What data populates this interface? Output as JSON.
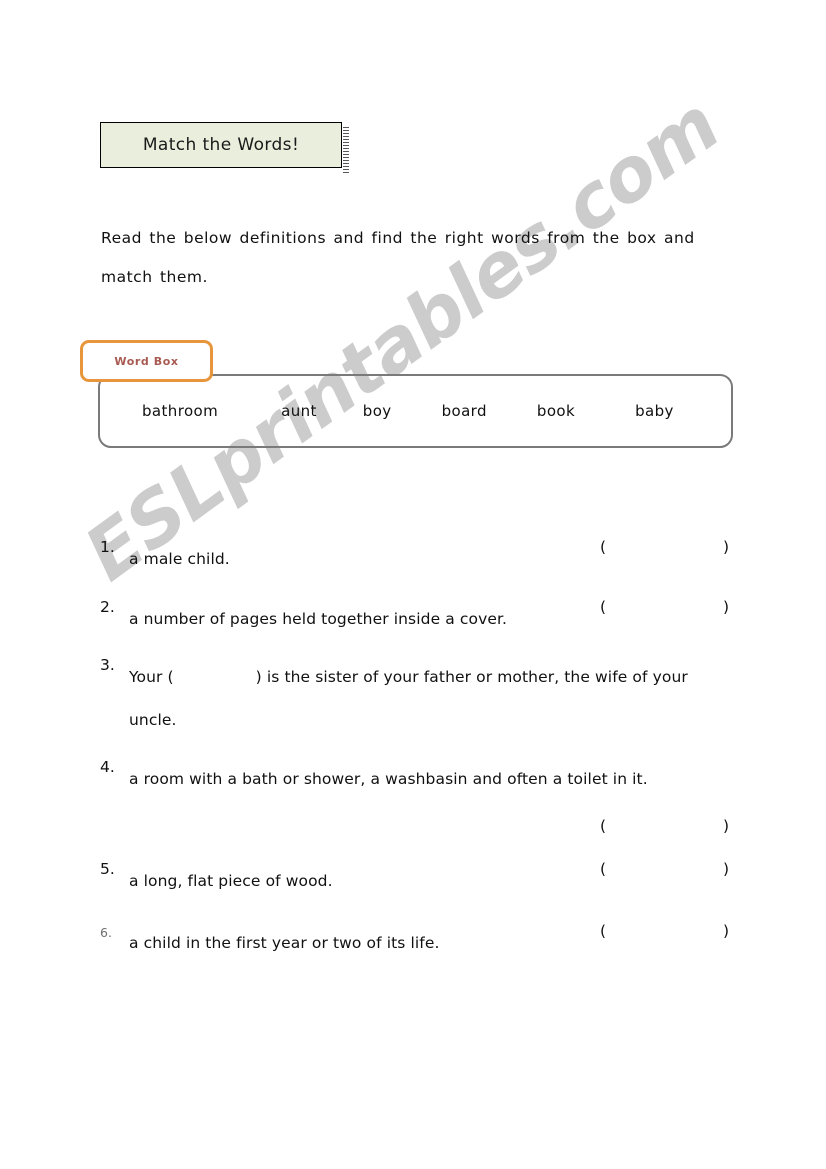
{
  "document": {
    "title": "Match the Words!",
    "instructions": "Read the below definitions and find the right words from the box and match them.",
    "watermark": "ESLprintables.com"
  },
  "word_box": {
    "tab_label": "Word Box",
    "words": [
      "bathroom",
      "aunt",
      "boy",
      "board",
      "book",
      "baby"
    ]
  },
  "questions": [
    {
      "number": "1.",
      "text": "a male child.",
      "paren_open": "(",
      "paren_close": ")"
    },
    {
      "number": "2.",
      "text": "a number of pages held together inside a cover.",
      "paren_open": "(",
      "paren_close": ")"
    },
    {
      "number": "3.",
      "text_before_blank": "Your  (",
      "text_after_blank": ")  is the sister of your father or mother,  the wife of your",
      "text_line2": "uncle."
    },
    {
      "number": "4.",
      "text": "a room with a bath or shower, a washbasin and often a toilet in it.",
      "paren_open": "(",
      "paren_close": ")"
    },
    {
      "number": "5.",
      "text": "a long, flat piece of wood.",
      "paren_open": "(",
      "paren_close": ")"
    },
    {
      "number": "6.",
      "text": "a child in the first year or two of its life.",
      "paren_open": "(",
      "paren_close": ")"
    }
  ],
  "colors": {
    "title_background": "#eaeedd",
    "tab_border": "#e8963c",
    "tab_text": "#a85a52",
    "wordbox_border": "#7a7a7a",
    "watermark": "#cccccc",
    "text": "#111111"
  }
}
